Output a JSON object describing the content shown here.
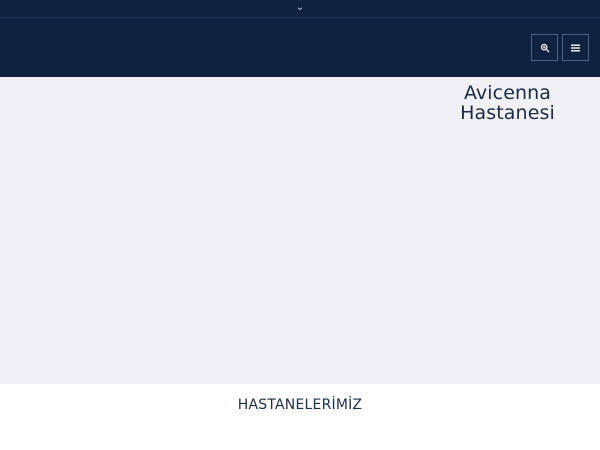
{
  "topbar": {
    "toggle_icon": "chevron-down-icon",
    "toggle_glyph": "⌄"
  },
  "header": {
    "search_icon": "search-icon",
    "menu_icon": "hamburger-menu-icon"
  },
  "hero": {
    "title_line1": "Avicenna",
    "title_line2": "Hastanesi"
  },
  "section": {
    "title": "HASTANELERİMİZ"
  },
  "colors": {
    "header_bg": "#0f2341",
    "hero_bg": "#f0f0f5",
    "text_dark": "#1b2b45",
    "icon_border": "#4b6285",
    "icon_color": "#ffffff"
  }
}
